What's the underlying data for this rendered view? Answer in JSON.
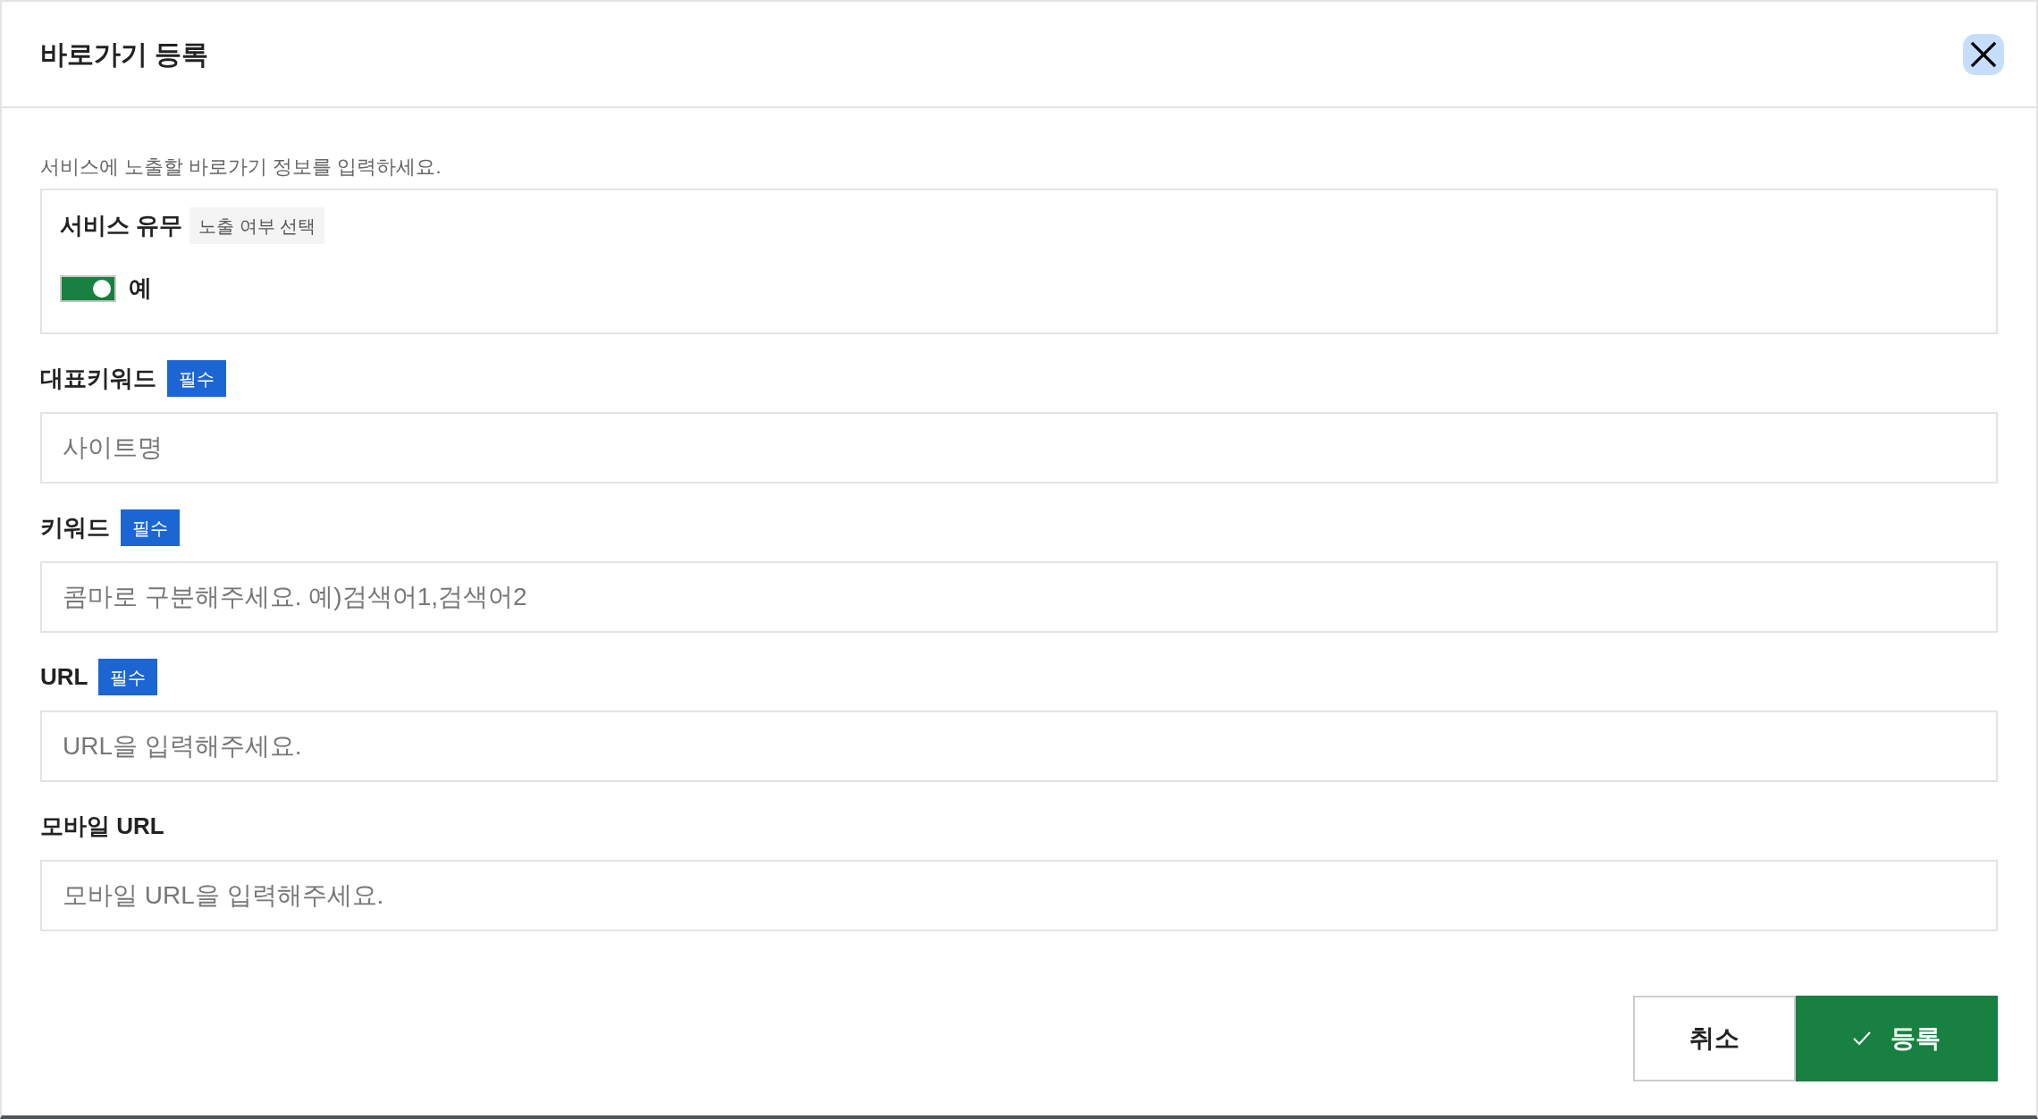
{
  "dialog": {
    "title": "바로가기 등록"
  },
  "description": "서비스에 노출할 바로가기 정보를 입력하세요.",
  "service": {
    "label": "서비스 유무",
    "tag": "노출 여부 선택",
    "toggle": {
      "on": true,
      "label": "예"
    }
  },
  "fields": [
    {
      "label": "대표키워드",
      "badge": "필수",
      "placeholder": "사이트명"
    },
    {
      "label": "키워드",
      "badge": "필수",
      "placeholder": "콤마로 구분해주세요. 예)검색어1,검색어2"
    },
    {
      "label": "URL",
      "badge": "필수",
      "placeholder": "URL을 입력해주세요."
    },
    {
      "label": "모바일 URL",
      "placeholder": "모바일 URL을 입력해주세요."
    }
  ],
  "buttons": [
    {
      "label": "취소",
      "kind": "secondary"
    },
    {
      "label": "등록",
      "kind": "primary"
    }
  ]
}
